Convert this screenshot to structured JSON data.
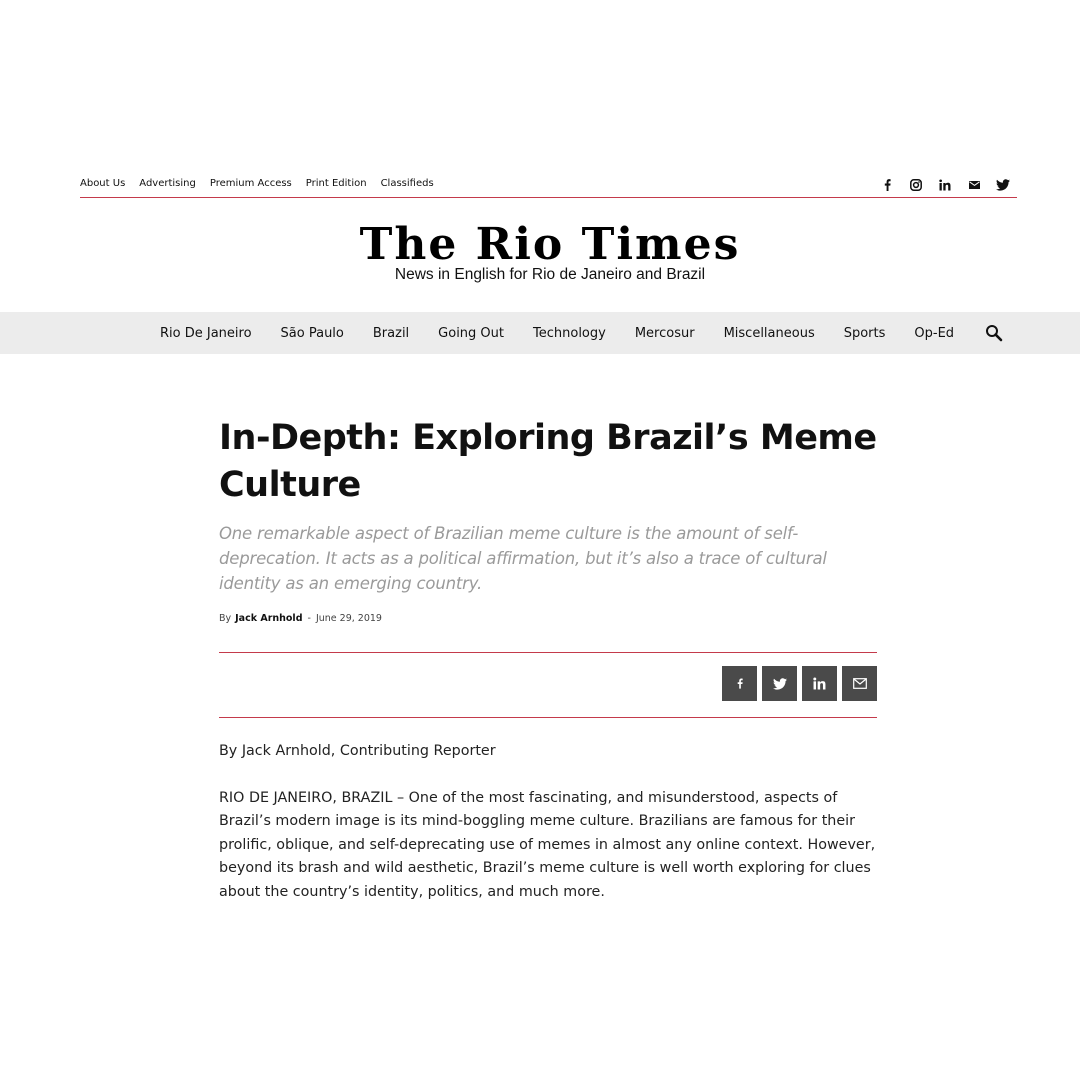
{
  "top_links": [
    "About Us",
    "Advertising",
    "Premium Access",
    "Print Edition",
    "Classifieds"
  ],
  "top_social_icons": [
    "facebook-icon",
    "instagram-icon",
    "linkedin-icon",
    "mail-icon",
    "twitter-icon"
  ],
  "masthead": {
    "title": "The Rio Times",
    "tagline": "News in English for Rio de Janeiro and Brazil"
  },
  "nav": {
    "items": [
      "Rio De Janeiro",
      "São Paulo",
      "Brazil",
      "Going Out",
      "Technology",
      "Mercosur",
      "Miscellaneous",
      "Sports",
      "Op-Ed"
    ],
    "search_icon": "search-icon"
  },
  "article": {
    "headline": "In-Depth: Exploring Brazil’s Meme Culture",
    "subtitle": "One remarkable aspect of Brazilian meme culture is the amount of self-deprecation. It acts as a political affirmation, but it’s also a trace of cultural identity as an emerging country.",
    "by": "By",
    "author": "Jack Arnhold",
    "separator": "-",
    "date": "June 29, 2019",
    "share_icons": [
      "facebook-icon",
      "twitter-icon",
      "linkedin-icon",
      "mail-icon"
    ],
    "paragraphs": [
      "By Jack Arnhold, Contributing Reporter",
      "RIO DE JANEIRO, BRAZIL – One of the most fascinating, and misunderstood, aspects of Brazil’s modern image is its mind-boggling meme culture. Brazilians are famous for their prolific, oblique, and self-deprecating use of memes in almost any online context. However, beyond its brash and wild aesthetic, Brazil’s meme culture is well worth exploring for clues about the country’s identity, politics, and much more."
    ]
  },
  "colors": {
    "accent_rule": "#c43a4b",
    "nav_bg": "#ececec",
    "share_bg": "#4a4a4a",
    "subtitle_text": "#9a9a9a"
  }
}
